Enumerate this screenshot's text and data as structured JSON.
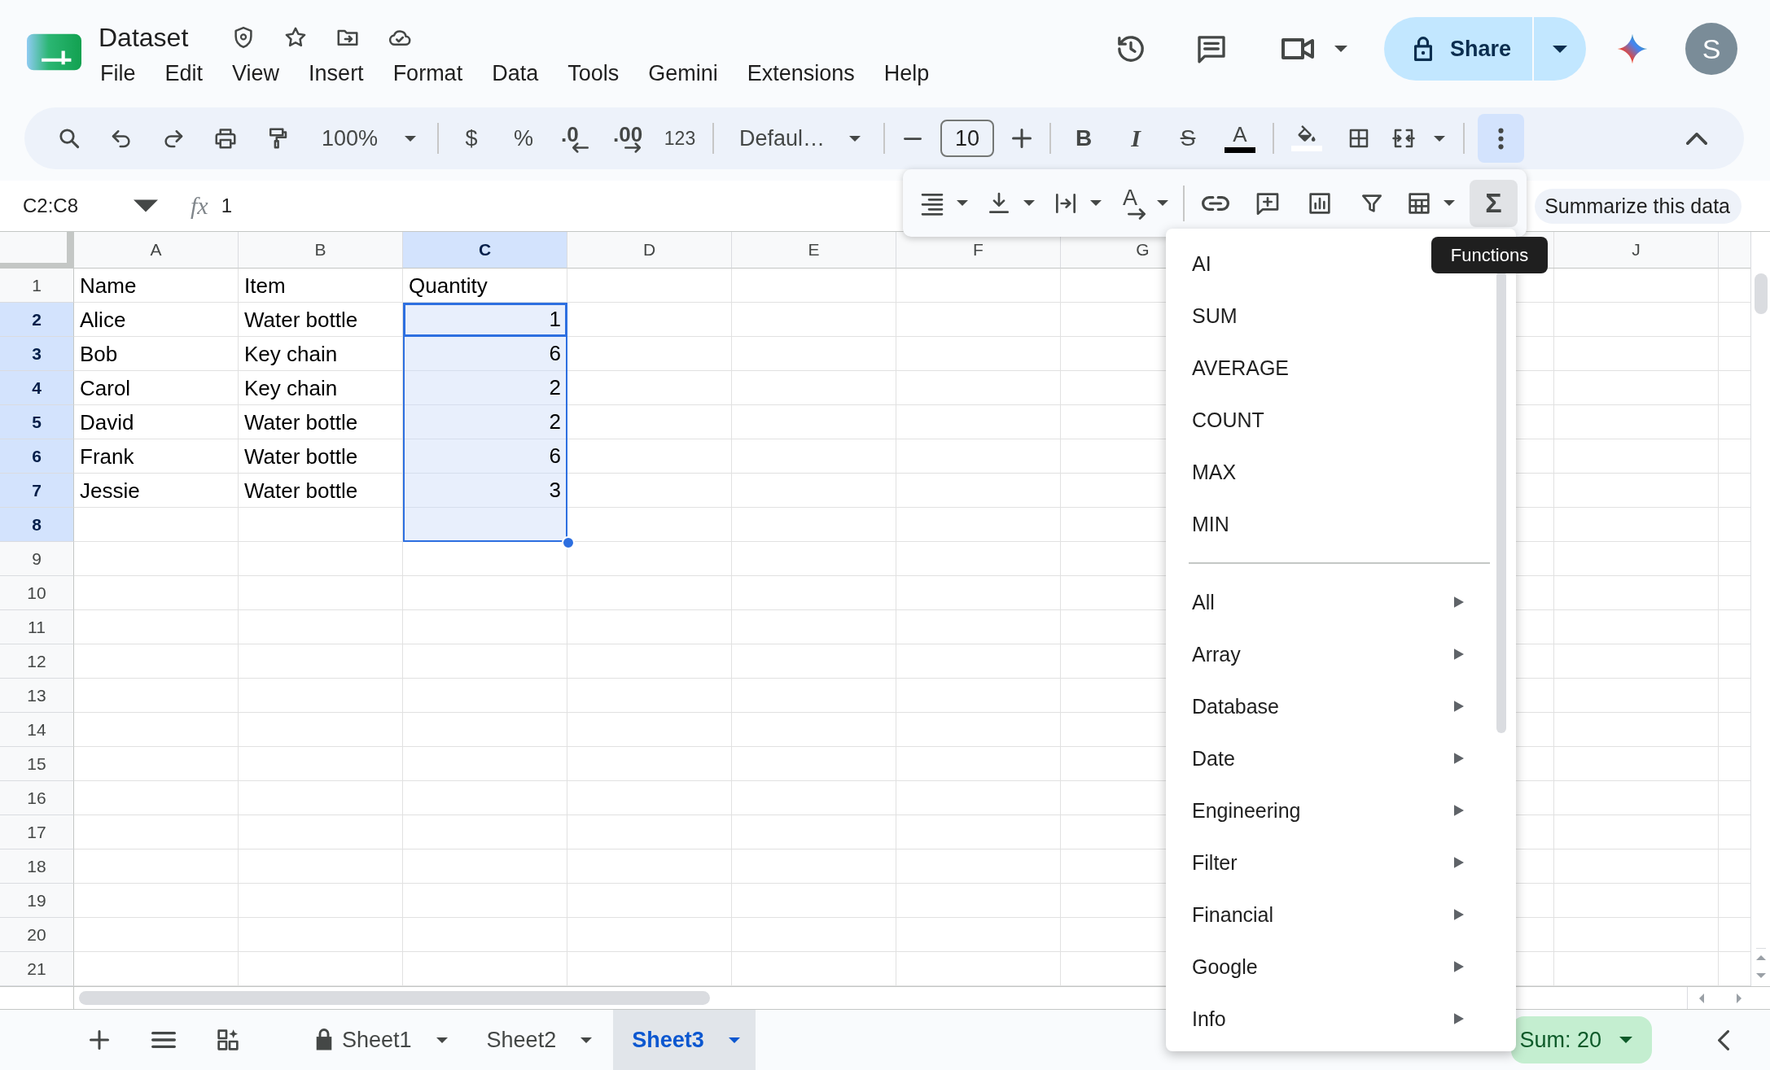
{
  "header": {
    "title": "Dataset",
    "menus": [
      "File",
      "Edit",
      "View",
      "Insert",
      "Format",
      "Data",
      "Tools",
      "Gemini",
      "Extensions",
      "Help"
    ],
    "share": "Share",
    "avatar": "S"
  },
  "toolbar": {
    "zoom": "100%",
    "currency": "$",
    "percent": "%",
    "decrease_decimal": ".0",
    "increase_decimal": ".00",
    "number_format": "123",
    "font": "Defaul…",
    "font_size": "10",
    "bold": "B",
    "italic": "I",
    "strikethrough": "S",
    "text_color": "A",
    "more_selected": true
  },
  "more_toolbar": {
    "text_rotation": "A",
    "functions": "Σ",
    "functions_selected": true,
    "tooltip": "Functions"
  },
  "formula_bar": {
    "name_box": "C2:C8",
    "fx": "fx",
    "formula": "1",
    "summarize": "Summarize this data"
  },
  "sheet": {
    "columns": [
      {
        "kind": "column",
        "label": "A",
        "selected": false
      },
      {
        "kind": "column",
        "label": "B",
        "selected": false
      },
      {
        "kind": "column",
        "label": "C",
        "selected": true
      },
      {
        "kind": "column",
        "label": "D",
        "selected": false
      },
      {
        "kind": "column",
        "label": "E",
        "selected": false
      },
      {
        "kind": "column",
        "label": "F",
        "selected": false
      },
      {
        "kind": "column",
        "label": "G",
        "selected": false
      },
      {
        "kind": "covered"
      },
      {
        "kind": "covered"
      },
      {
        "kind": "column",
        "label": "J",
        "selected": false
      }
    ],
    "rows": [
      {
        "label": "1",
        "selected": false,
        "cells": [
          {
            "text": "Name",
            "kind": "text"
          },
          {
            "text": "Item",
            "kind": "text"
          },
          {
            "text": "Quantity",
            "kind": "text"
          }
        ]
      },
      {
        "label": "2",
        "selected": true,
        "cells": [
          {
            "text": "Alice",
            "kind": "text"
          },
          {
            "text": "Water bottle",
            "kind": "text"
          },
          {
            "text": "1",
            "kind": "number"
          }
        ]
      },
      {
        "label": "3",
        "selected": true,
        "cells": [
          {
            "text": "Bob",
            "kind": "text"
          },
          {
            "text": "Key chain",
            "kind": "text"
          },
          {
            "text": "6",
            "kind": "number"
          }
        ]
      },
      {
        "label": "4",
        "selected": true,
        "cells": [
          {
            "text": "Carol",
            "kind": "text"
          },
          {
            "text": "Key chain",
            "kind": "text"
          },
          {
            "text": "2",
            "kind": "number"
          }
        ]
      },
      {
        "label": "5",
        "selected": true,
        "cells": [
          {
            "text": "David",
            "kind": "text"
          },
          {
            "text": "Water bottle",
            "kind": "text"
          },
          {
            "text": "2",
            "kind": "number"
          }
        ]
      },
      {
        "label": "6",
        "selected": true,
        "cells": [
          {
            "text": "Frank",
            "kind": "text"
          },
          {
            "text": "Water bottle",
            "kind": "text"
          },
          {
            "text": "6",
            "kind": "number"
          }
        ]
      },
      {
        "label": "7",
        "selected": true,
        "cells": [
          {
            "text": "Jessie",
            "kind": "text"
          },
          {
            "text": "Water bottle",
            "kind": "text"
          },
          {
            "text": "3",
            "kind": "number"
          }
        ]
      },
      {
        "label": "8",
        "selected": true
      },
      {
        "label": "9",
        "selected": false
      },
      {
        "label": "10",
        "selected": false
      },
      {
        "label": "11",
        "selected": false
      },
      {
        "label": "12",
        "selected": false
      },
      {
        "label": "13",
        "selected": false
      },
      {
        "label": "14",
        "selected": false
      },
      {
        "label": "15",
        "selected": false
      },
      {
        "label": "16",
        "selected": false
      },
      {
        "label": "17",
        "selected": false
      },
      {
        "label": "18",
        "selected": false
      },
      {
        "label": "19",
        "selected": false
      },
      {
        "label": "20",
        "selected": false
      },
      {
        "label": "21",
        "selected": false
      }
    ]
  },
  "functions_menu": {
    "functions": [
      "AI",
      "SUM",
      "AVERAGE",
      "COUNT",
      "MAX",
      "MIN"
    ],
    "categories": [
      "All",
      "Array",
      "Database",
      "Date",
      "Engineering",
      "Filter",
      "Financial",
      "Google",
      "Info"
    ]
  },
  "sheet_tabs": [
    {
      "label": "Sheet1",
      "locked": true,
      "selected": false
    },
    {
      "label": "Sheet2",
      "locked": false,
      "selected": false
    },
    {
      "label": "Sheet3",
      "locked": false,
      "selected": true
    }
  ],
  "status": {
    "sum": "Sum: 20"
  }
}
